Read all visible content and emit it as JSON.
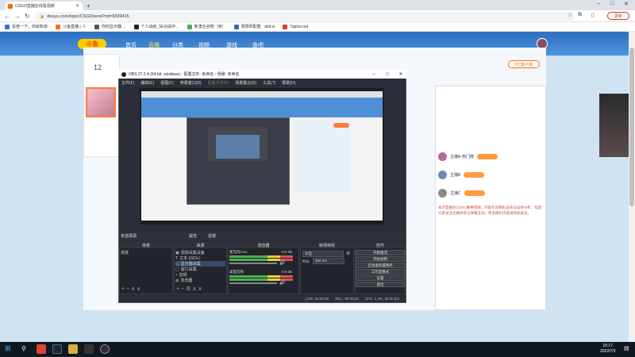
{
  "browser": {
    "tab_title": "CSGO直播在线看视频",
    "url": "douyu.com/topic/CSGOsend?rid=8399415",
    "update_label": "更新",
    "bookmarks": [
      "百度一下，你就知道",
      "斗鱼直播 | ·ʕ·",
      "你的显示器 ...",
      "个人战绩_5E对战平...",
      "新澳五谷物（身）",
      "阴阳师配置 · abit.io",
      "Taplus.net"
    ]
  },
  "douyu": {
    "logo": "斗鱼",
    "nav": [
      "首页",
      "直播",
      "分类",
      "视频",
      "游戏",
      "鱼吧"
    ],
    "count": "12",
    "pc_button": "PC客户端",
    "right_rows": [
      "主播A·热门榜",
      "主播B",
      "主播C"
    ],
    "right_text": "本次直播为CSGO赛事回顾，内容包含精彩击杀与战术分析，欢迎大家关注主播并参与弹幕互动，更多精彩内容请持续关注。"
  },
  "obs": {
    "title": "OBS 27.2.4 (64-bit, windows) - 配置文件: 未命名 - 场景: 未命名",
    "menu": [
      "文件(F)",
      "编辑(E)",
      "视图(V)",
      "停靠窗口(D)",
      "配置文件(P)",
      "场景集合(S)",
      "工具(T)",
      "帮助(H)"
    ],
    "scene_bar": "未选择源",
    "scene_props": "属性",
    "scene_filters": "滤镜",
    "docks": {
      "scenes": "场景",
      "sources": "来源",
      "mixer": "混音器",
      "transitions": "转场特效",
      "controls": "控件"
    },
    "scene_list": [
      "场景"
    ],
    "source_list": [
      "视频采集设备",
      "文本 (GDI+)",
      "显示器采集",
      "窗口采集",
      "音频",
      "浏览器"
    ],
    "mixer": {
      "track1": "桌面音频",
      "track1_db": "0.0 dB",
      "track2": "麦克风/Aux",
      "track2_db": "0.0 dB"
    },
    "transition": {
      "type": "淡出",
      "duration_label": "时长",
      "duration": "300 ms"
    },
    "controls": [
      "开始推流",
      "开始录制",
      "启动虚拟摄像机",
      "工作室模式",
      "设置",
      "退出"
    ],
    "status": {
      "live": "LIVE: 00:00:00",
      "rec": "REC: 00:00:00",
      "cpu": "CPU: 2.4%, 30.00 fps"
    }
  },
  "taskbar": {
    "time": "15:17",
    "date": "2022/7/3"
  }
}
